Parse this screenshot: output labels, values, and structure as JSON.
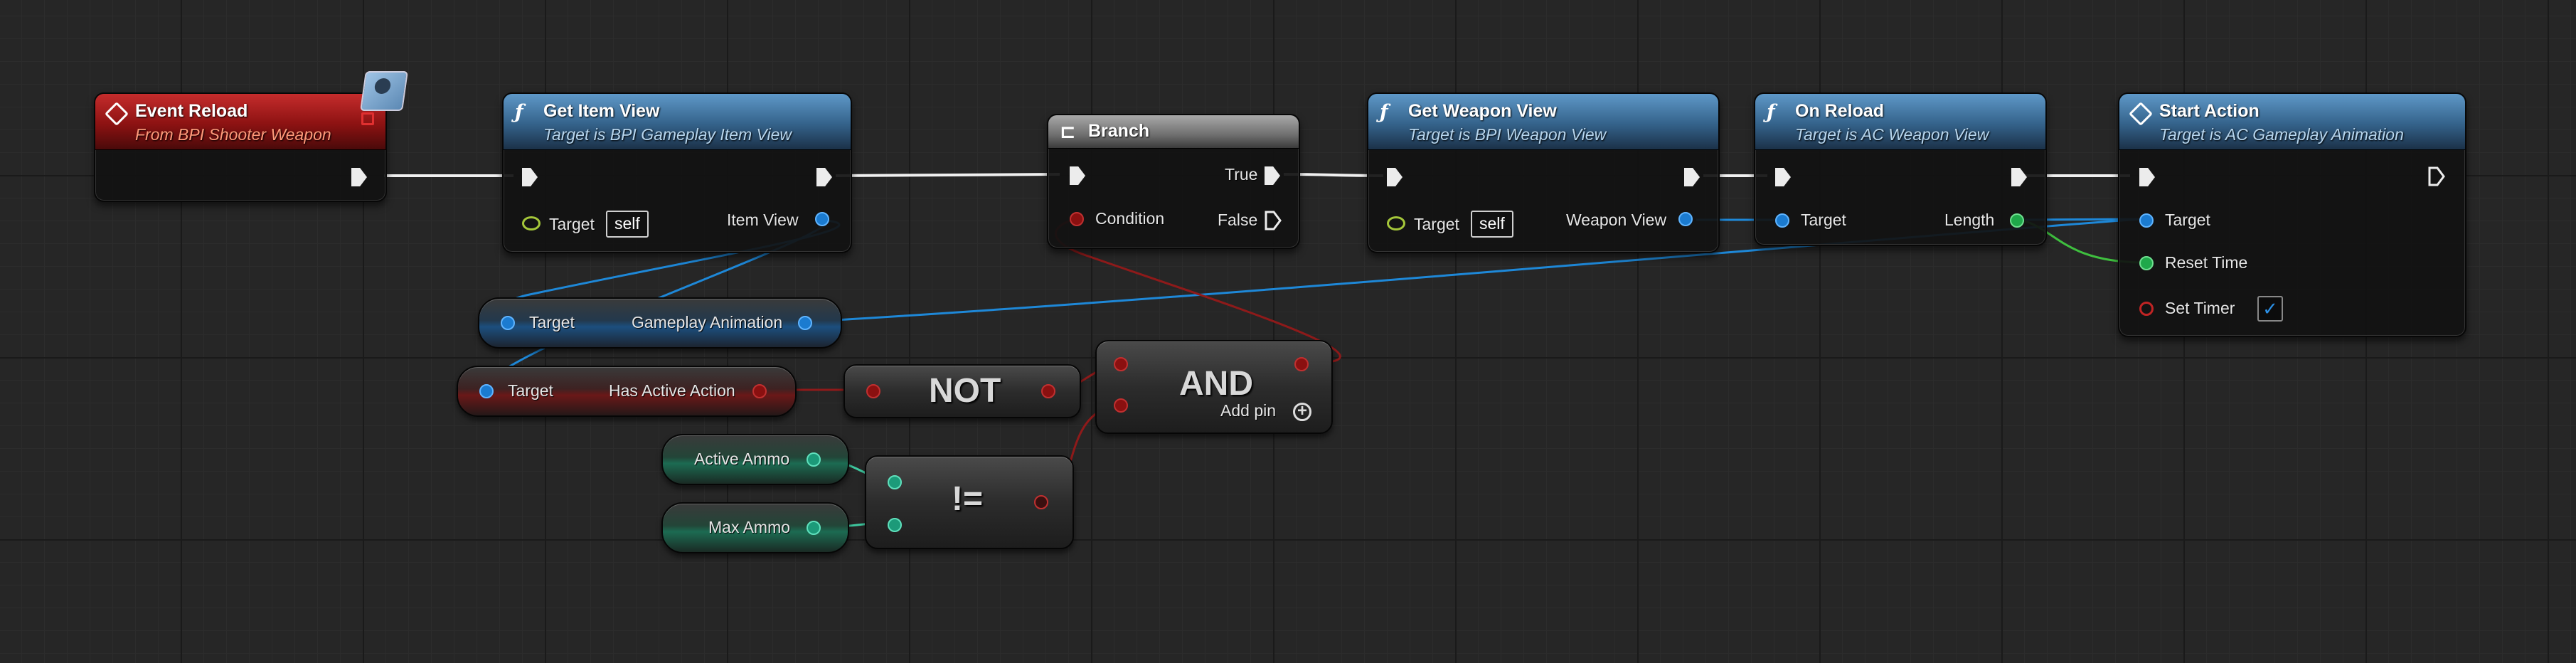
{
  "nodes": {
    "event_reload": {
      "title": "Event Reload",
      "subtitle": "From BPI Shooter Weapon"
    },
    "get_item_view": {
      "title": "Get Item View",
      "subtitle": "Target is BPI Gameplay Item View",
      "target_label": "Target",
      "target_value": "self",
      "output_label": "Item View"
    },
    "branch": {
      "title": "Branch",
      "true_label": "True",
      "false_label": "False",
      "condition_label": "Condition"
    },
    "get_weapon_view": {
      "title": "Get Weapon View",
      "subtitle": "Target is BPI Weapon View",
      "target_label": "Target",
      "target_value": "self",
      "output_label": "Weapon View"
    },
    "on_reload": {
      "title": "On Reload",
      "subtitle": "Target is AC Weapon View",
      "target_label": "Target",
      "output_label": "Length"
    },
    "start_action": {
      "title": "Start Action",
      "subtitle": "Target is AC Gameplay Animation",
      "target_label": "Target",
      "reset_time_label": "Reset Time",
      "set_timer_label": "Set Timer",
      "set_timer_checked": true
    },
    "gameplay_animation": {
      "target_label": "Target",
      "output_label": "Gameplay Animation"
    },
    "has_active_action": {
      "target_label": "Target",
      "output_label": "Has Active Action"
    },
    "not_node": {
      "label": "NOT"
    },
    "and_node": {
      "label": "AND",
      "add_pin_label": "Add pin"
    },
    "active_ammo": {
      "label": "Active Ammo"
    },
    "max_ammo": {
      "label": "Max Ammo"
    },
    "not_equal": {
      "label": "!="
    }
  },
  "icons": {
    "event": "diamond-icon",
    "function": "function-icon",
    "branch": "branch-icon",
    "interface": "interface-icon",
    "delegate": "delegate-pin-icon",
    "add_pin": "plus-circle-icon",
    "check": "checkmark-icon"
  },
  "colors": {
    "event_header": "#c52c2c",
    "function_header": "#5e98c8",
    "branch_header": "#a9a9a9",
    "exec_wire": "#ffffff",
    "object_wire": "#1e88d8",
    "bool_wire": "#8e1a1a",
    "float_wire": "#3fbf3f",
    "int_wire": "#3fc9a0"
  }
}
